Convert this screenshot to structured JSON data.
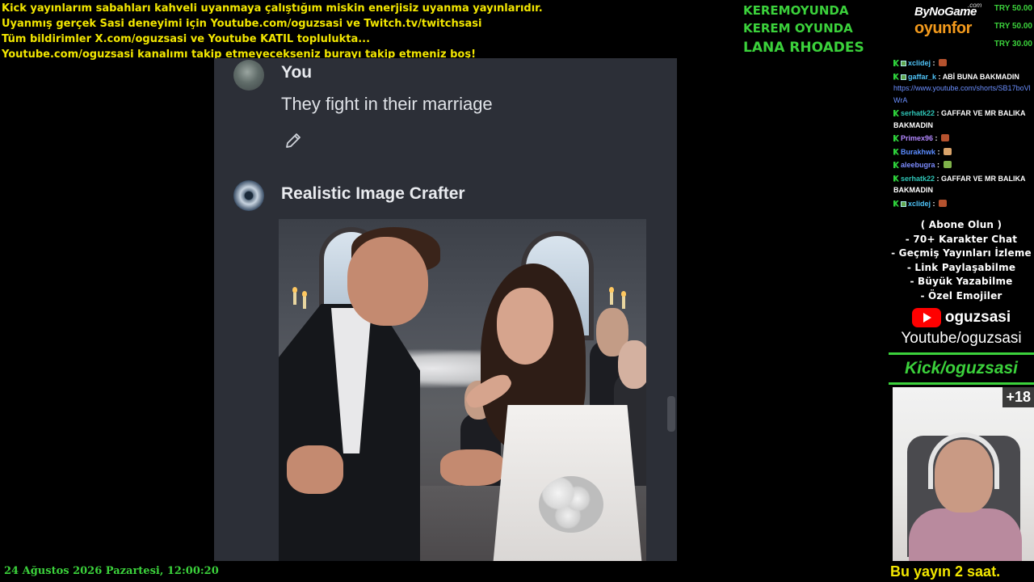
{
  "banner": {
    "line1": "Kick yayınlarım sabahları kahveli uyanmaya çalıştığım miskin enerjisiz uyanma yayınlarıdır.",
    "line2": "Uyanmış gerçek Sasi deneyimi için Youtube.com/oguzsasi ve Twitch.tv/twitchsasi",
    "line3": "Tüm bildirimler X.com/oguzsasi ve Youtube KATIL toplulukta...",
    "line4": "Youtube.com/oguzsasi kanalımı takip etmeyecekseniz burayı takip etmeniz boş!"
  },
  "names": [
    "KEREMOYUNDA",
    "KEREM OYUNDA",
    "LANA RHOADES"
  ],
  "sponsor": {
    "top": "ByNoGame",
    "com": ".com",
    "bottom": "oyunfor"
  },
  "donations": [
    "TRY 50.00",
    "TRY 50.00",
    "TRY 30.00"
  ],
  "chat": [
    {
      "user": "xclidej",
      "color": "#4fc3f7",
      "text": "",
      "emote": "#b5522e"
    },
    {
      "user": "gaffar_k",
      "color": "#4fc3f7",
      "text": "ABİ BUNA BAKMADIN",
      "link": "https://www.youtube.com/shorts/SB17boVlWrA"
    },
    {
      "user": "serhatk22",
      "color": "#2ec4b6",
      "text": "GAFFAR VE MR BALIKA BAKMADIN"
    },
    {
      "user": "Primex96",
      "color": "#b388ff",
      "text": "",
      "emote": "#b5522e"
    },
    {
      "user": "Burakhwk",
      "color": "#5b8cff",
      "text": "",
      "emote": "#d9a36a"
    },
    {
      "user": "aleebugra",
      "color": "#7c8cff",
      "text": "",
      "emote": "#7fb24a"
    },
    {
      "user": "serhatk22",
      "color": "#2ec4b6",
      "text": "GAFFAR VE MR BALIKA BAKMADIN"
    },
    {
      "user": "xclidej",
      "color": "#4fc3f7",
      "text": "",
      "emote": "#b5522e"
    }
  ],
  "promo": {
    "lines": [
      "( Abone Olun )",
      "- 70+ Karakter Chat",
      "- Geçmiş Yayınları İzleme",
      "- Link Paylaşabilme",
      "- Büyük Yazabilme",
      "- Özel Emojiler"
    ],
    "yt_name": "oguzsasi",
    "yt_url": "Youtube/oguzsasi",
    "kick": "Kick/oguzsasi"
  },
  "webcam": {
    "badge": "+18",
    "caption": "Bu yayın 2 saat."
  },
  "datetime": "24 Ağustos 2026 Pazartesi, 12:00:20",
  "conversation": {
    "user_name": "You",
    "user_message": "They fight in their marriage",
    "bot_name": "Realistic Image Crafter"
  }
}
